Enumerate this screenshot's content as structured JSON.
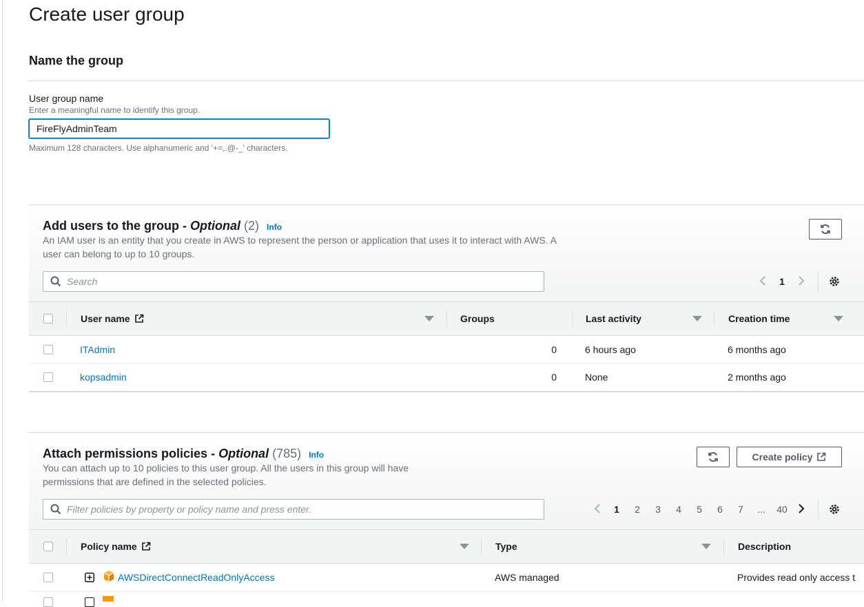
{
  "page": {
    "title": "Create user group"
  },
  "name_section": {
    "title": "Name the group",
    "label": "User group name",
    "description": "Enter a meaningful name to identify this group.",
    "value": "FireFlyAdminTeam",
    "constraint": "Maximum 128 characters. Use alphanumeric and '+=,.@-_' characters."
  },
  "users_section": {
    "title": "Add users to the group - ",
    "optional": "Optional",
    "count": "(2)",
    "info": "Info",
    "description": "An IAM user is an entity that you create in AWS to represent the person or application that uses it to interact with AWS. A user can belong to up to 10 groups.",
    "search_placeholder": "Search",
    "pagination": {
      "current": "1"
    },
    "columns": [
      "User name",
      "Groups",
      "Last activity",
      "Creation time"
    ],
    "rows": [
      {
        "user_name": "ITAdmin",
        "groups": "0",
        "last_activity": "6 hours ago",
        "creation_time": "6 months ago"
      },
      {
        "user_name": "kopsadmin",
        "groups": "0",
        "last_activity": "None",
        "creation_time": "2 months ago"
      }
    ]
  },
  "policies_section": {
    "title": "Attach permissions policies - ",
    "optional": "Optional",
    "count": "(785)",
    "info": "Info",
    "description": "You can attach up to 10 policies to this user group. All the users in this group will have permissions that are defined in the selected policies.",
    "create_policy_label": "Create policy",
    "filter_placeholder": "Filter policies by property or policy name and press enter.",
    "pagination": {
      "pages": [
        "1",
        "2",
        "3",
        "4",
        "5",
        "6",
        "7",
        "...",
        "40"
      ],
      "current": "1"
    },
    "columns": [
      "Policy name",
      "Type",
      "Description"
    ],
    "rows": [
      {
        "policy_name": "AWSDirectConnectReadOnlyAccess",
        "type": "AWS managed",
        "description": "Provides read only access t"
      }
    ]
  },
  "colors": {
    "accent": "#0073bb",
    "focus": "#00a1c9",
    "aws_orange": "#ff9900",
    "text": "#16191f",
    "muted": "#687078"
  },
  "icons": [
    "refresh-icon",
    "external-link-icon",
    "search-icon",
    "settings-gear-icon",
    "chevron-left-icon",
    "chevron-right-icon",
    "sort-caret-icon",
    "expand-plus-icon",
    "aws-cube-icon"
  ]
}
